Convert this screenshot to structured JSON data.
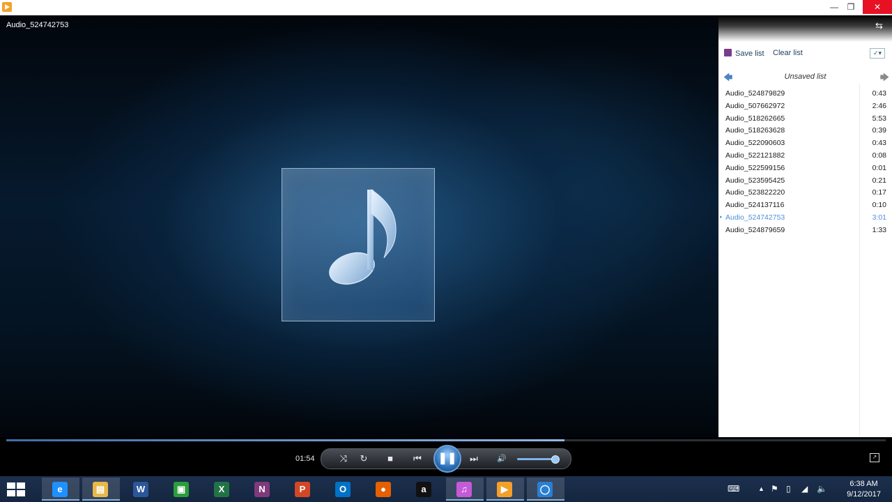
{
  "window": {
    "minimize_glyph": "—",
    "restore_glyph": "❐",
    "close_glyph": "✕"
  },
  "now_playing": {
    "title": "Audio_524742753",
    "art_icon": "music-note-icon"
  },
  "playlist": {
    "save_label": "Save list",
    "clear_label": "Clear list",
    "title": "Unsaved list",
    "items": [
      {
        "name": "Audio_524879829",
        "duration": "0:43"
      },
      {
        "name": "Audio_507662972",
        "duration": "2:46"
      },
      {
        "name": "Audio_518262665",
        "duration": "5:53"
      },
      {
        "name": "Audio_518263628",
        "duration": "0:39"
      },
      {
        "name": "Audio_522090603",
        "duration": "0:43"
      },
      {
        "name": "Audio_522121882",
        "duration": "0:08"
      },
      {
        "name": "Audio_522599156",
        "duration": "0:01"
      },
      {
        "name": "Audio_523595425",
        "duration": "0:21"
      },
      {
        "name": "Audio_523822220",
        "duration": "0:17"
      },
      {
        "name": "Audio_524137116",
        "duration": "0:10"
      },
      {
        "name": "Audio_524742753",
        "duration": "3:01"
      },
      {
        "name": "Audio_524879659",
        "duration": "1:33"
      }
    ],
    "active_index": 10
  },
  "controls": {
    "elapsed": "01:54",
    "seek_progress": 0.635,
    "volume_level": 0.9,
    "icons": {
      "shuffle": "⤨",
      "repeat": "↻",
      "stop": "■",
      "prev": "⏮",
      "play_pause": "❚❚",
      "next": "⏭",
      "mute": "🔊"
    }
  },
  "taskbar": {
    "apps": [
      {
        "name": "internet-explorer",
        "glyph": "e",
        "color": "#1e90ff",
        "active": true
      },
      {
        "name": "file-explorer",
        "glyph": "▤",
        "color": "#e8b84a",
        "active": true
      },
      {
        "name": "word",
        "glyph": "W",
        "color": "#2b579a",
        "active": false
      },
      {
        "name": "store",
        "glyph": "▣",
        "color": "#2a9d3c",
        "active": false
      },
      {
        "name": "excel",
        "glyph": "X",
        "color": "#217346",
        "active": false
      },
      {
        "name": "onenote",
        "glyph": "N",
        "color": "#80397b",
        "active": false
      },
      {
        "name": "powerpoint",
        "glyph": "P",
        "color": "#d24726",
        "active": false
      },
      {
        "name": "outlook",
        "glyph": "O",
        "color": "#0072c6",
        "active": false
      },
      {
        "name": "firefox",
        "glyph": "●",
        "color": "#e66000",
        "active": false
      },
      {
        "name": "amazon",
        "glyph": "a",
        "color": "#111111",
        "active": false
      },
      {
        "name": "itunes",
        "glyph": "♫",
        "color": "#c45ad8",
        "active": true
      },
      {
        "name": "media-player",
        "glyph": "▶",
        "color": "#f4a028",
        "active": true
      },
      {
        "name": "cortana",
        "glyph": "◯",
        "color": "#2a7fd4",
        "active": true
      }
    ],
    "time": "6:38 AM",
    "date": "9/12/2017"
  }
}
